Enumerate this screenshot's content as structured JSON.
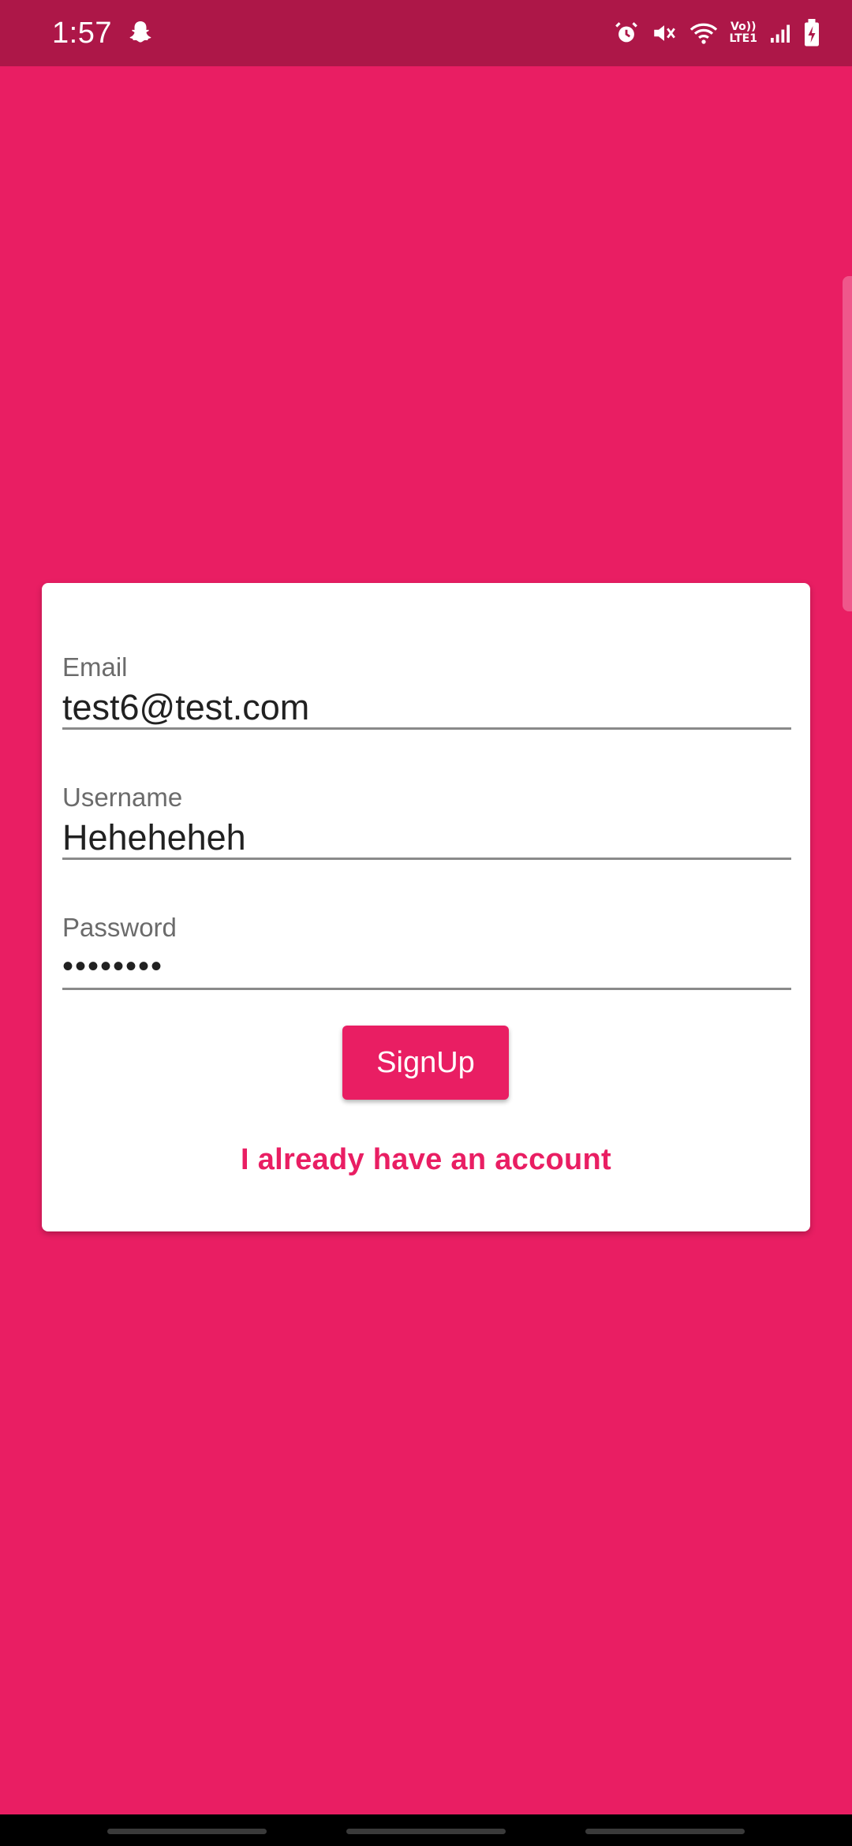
{
  "status_bar": {
    "time": "1:57",
    "icons": [
      "snapchat-icon",
      "alarm-icon",
      "mute-icon",
      "wifi-icon",
      "volte-icon",
      "signal-icon",
      "battery-charging-icon"
    ],
    "volte_label_top": "Vo))",
    "volte_label_bottom": "LTE1"
  },
  "form": {
    "email": {
      "label": "Email",
      "value": "test6@test.com"
    },
    "username": {
      "label": "Username",
      "value": "Heheheheh"
    },
    "password": {
      "label": "Password",
      "value": "••••••••"
    },
    "signup_label": "SignUp",
    "login_link": "I already have an account"
  },
  "colors": {
    "background": "#E91E63",
    "status_bar": "#AD1748",
    "accent": "#E91E63",
    "card": "#FFFFFF"
  }
}
